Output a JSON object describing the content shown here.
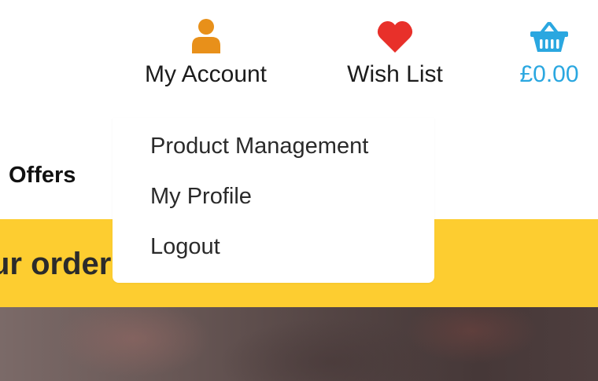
{
  "header": {
    "account": {
      "label": "My Account",
      "icon": "user-icon",
      "icon_color": "#e8901a"
    },
    "wishlist": {
      "label": "Wish List",
      "icon": "heart-icon",
      "icon_color": "#e8302a"
    },
    "basket": {
      "total": "£0.00",
      "icon": "basket-icon",
      "color": "#2aa7e0"
    }
  },
  "nav": {
    "offers_label": "Offers"
  },
  "banner": {
    "text": "Your order",
    "visible_text": "ur order",
    "background": "#fdcd30"
  },
  "account_menu": {
    "items": [
      {
        "label": "Product Management"
      },
      {
        "label": "My Profile"
      },
      {
        "label": "Logout"
      }
    ]
  }
}
